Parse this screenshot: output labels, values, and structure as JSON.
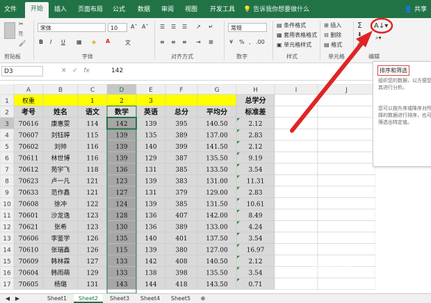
{
  "tabs": [
    "文件",
    "开始",
    "插入",
    "页面布局",
    "公式",
    "数据",
    "审阅",
    "视图",
    "开发工具"
  ],
  "active_tab": "开始",
  "tell_me": "告诉我你想要做什么",
  "share": "共享",
  "ribbon": {
    "clipboard_label": "剪贴板",
    "font_name": "宋体",
    "font_size": "10",
    "font_label": "字体",
    "align_label": "对齐方式",
    "number_format": "常规",
    "number_label": "数字",
    "styles": [
      "条件格式",
      "套用表格格式",
      "单元格样式"
    ],
    "styles_label": "样式",
    "cells": [
      "插入",
      "删除",
      "格式"
    ],
    "cells_label": "单元格",
    "edit_label": "编辑",
    "bold": "B",
    "italic": "I",
    "underline": "U",
    "percent": "%",
    "comma": ","
  },
  "formula_bar": {
    "name_box": "D3",
    "fx": "fx",
    "value": "142"
  },
  "columns": [
    "A",
    "B",
    "C",
    "D",
    "E",
    "F",
    "G",
    "H",
    "I",
    "J"
  ],
  "row1": [
    "权重",
    "",
    "1",
    "2",
    "3",
    "",
    "",
    "总学分"
  ],
  "headers": [
    "考号",
    "姓名",
    "语文",
    "数学",
    "英语",
    "总分",
    "平均分",
    "标准差"
  ],
  "rows": [
    [
      "70616",
      "康惠雯",
      "114",
      "142",
      "139",
      "395",
      "140.50",
      "2.12"
    ],
    [
      "70607",
      "刘钰婷",
      "115",
      "139",
      "135",
      "389",
      "137.00",
      "2.83"
    ],
    [
      "70602",
      "刘帅",
      "116",
      "139",
      "140",
      "399",
      "141.50",
      "2.12"
    ],
    [
      "70611",
      "林世博",
      "116",
      "139",
      "142",
      "129",
      "387",
      "135.50",
      "9.19"
    ],
    [
      "70612",
      "苑宇飞",
      "118",
      "136",
      "131",
      "385",
      "133.50",
      "3.54"
    ],
    [
      "70623",
      "卢一凡",
      "121",
      "123",
      "139",
      "383",
      "131.00",
      "11.31"
    ],
    [
      "70633",
      "范作鑫",
      "121",
      "127",
      "131",
      "379",
      "129.00",
      "2.83"
    ],
    [
      "70608",
      "徐冲",
      "122",
      "124",
      "139",
      "385",
      "131.50",
      "10.61"
    ],
    [
      "70601",
      "沙龙逸",
      "123",
      "128",
      "136",
      "407",
      "142.00",
      "8.49"
    ],
    [
      "70621",
      "张希",
      "123",
      "130",
      "136",
      "389",
      "133.00",
      "4.24"
    ],
    [
      "70606",
      "李鉴学",
      "126",
      "135",
      "140",
      "401",
      "137.50",
      "3.54"
    ],
    [
      "70610",
      "张瑞鑫",
      "126",
      "115",
      "139",
      "380",
      "127.00",
      "16.97"
    ],
    [
      "70609",
      "韩林霖",
      "127",
      "133",
      "142",
      "408",
      "140.50",
      "2.12"
    ],
    [
      "70604",
      "韩雨萌",
      "129",
      "133",
      "138",
      "398",
      "135.50",
      "3.54"
    ],
    [
      "70605",
      "杨璐",
      "131",
      "143",
      "144",
      "418",
      "143.50",
      "0.71"
    ]
  ],
  "tooltip": {
    "title": "排序和筛选",
    "body": "组织您的数据，以方便您对其进行分析。",
    "more": "您可以按升序或降序对所选择的数据进行排序，也可以筛选出特定值。"
  },
  "sheets": [
    "Sheet1",
    "Sheet2",
    "Sheet3",
    "Sheet4",
    "Sheet5"
  ],
  "active_sheet": "Sheet2",
  "watermark": "搜狗指南",
  "watermark_url": "zhinan.sogou.com",
  "colors": {
    "excel_green": "#217346",
    "yellow": "#ffff00",
    "gray": "#d9d9d9",
    "dark_gray": "#a6a6a6",
    "arrow_red": "#e02424"
  }
}
